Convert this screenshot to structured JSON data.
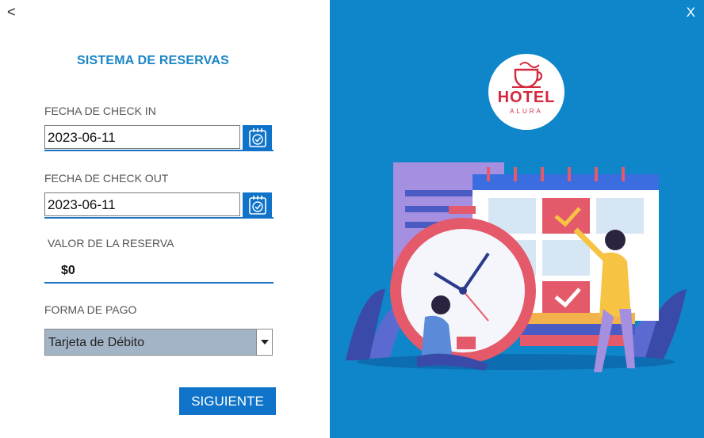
{
  "nav": {
    "back_label": "<",
    "close_label": "X"
  },
  "form": {
    "title": "SISTEMA DE RESERVAS",
    "checkin": {
      "label": "FECHA DE CHECK IN",
      "value": "2023-06-11",
      "icon": "calendar-check-icon"
    },
    "checkout": {
      "label": "FECHA DE CHECK OUT",
      "value": "2023-06-11",
      "icon": "calendar-check-icon"
    },
    "valor": {
      "label": "VALOR DE LA RESERVA",
      "value": "$0"
    },
    "pago": {
      "label": "FORMA DE PAGO",
      "selected": "Tarjeta de Débito"
    },
    "next_button": "SIGUIENTE"
  },
  "brand": {
    "logo_top": "HOTEL",
    "logo_bottom": "ALURA",
    "accent_color": "#0f86c9",
    "logo_color": "#d4283c"
  }
}
